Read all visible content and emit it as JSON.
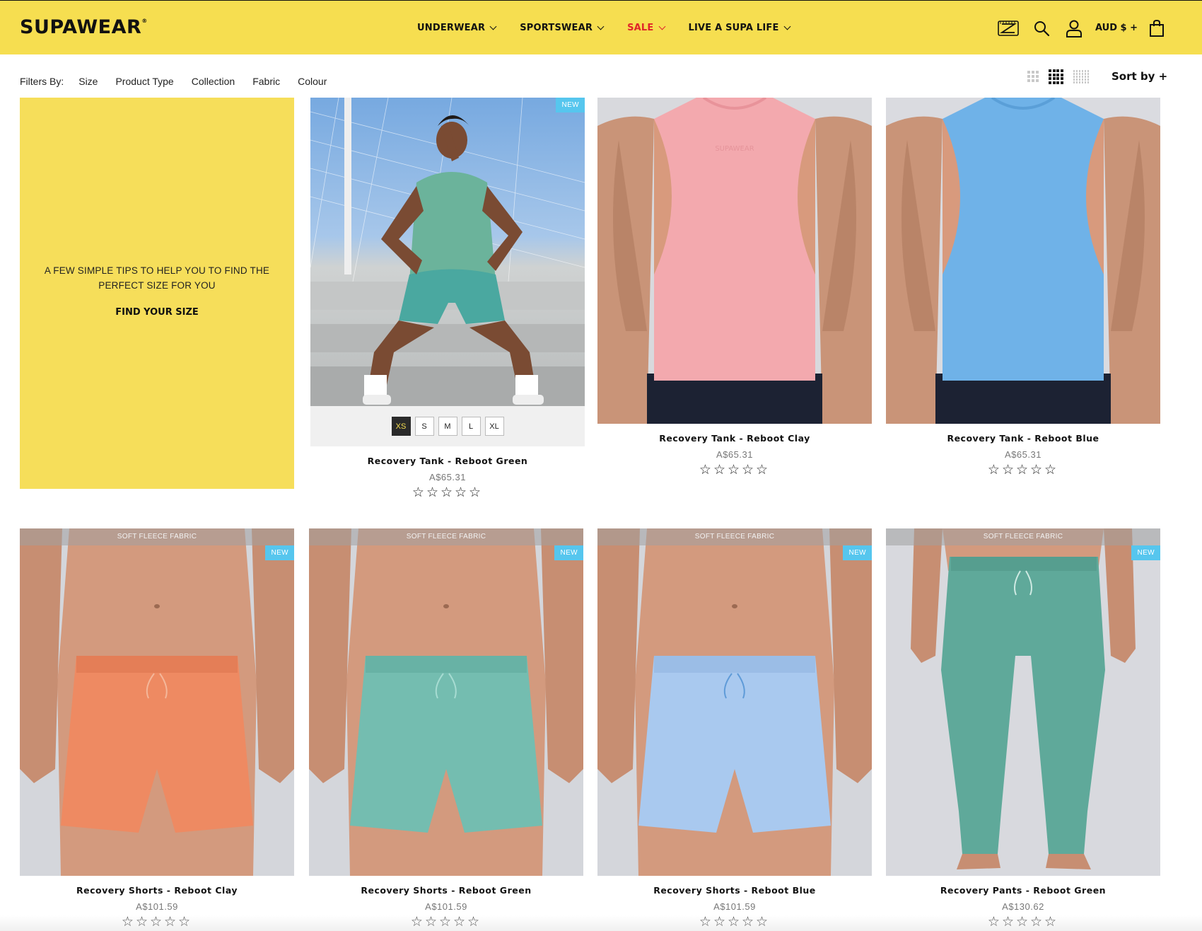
{
  "brand": {
    "logo_text": "SUPAWEAR",
    "logo_mark": "®"
  },
  "nav": {
    "items": [
      {
        "label": "UNDERWEAR"
      },
      {
        "label": "SPORTSWEAR"
      },
      {
        "label": "SALE"
      },
      {
        "label": "LIVE A SUPA LIFE"
      }
    ]
  },
  "header_right": {
    "currency": "AUD $ +"
  },
  "filters": {
    "label": "Filters By:",
    "items": [
      "Size",
      "Product Type",
      "Collection",
      "Fabric",
      "Colour"
    ]
  },
  "sort": {
    "label": "Sort by +"
  },
  "promo": {
    "text": "A FEW SIMPLE TIPS TO HELP YOU TO FIND THE PERFECT SIZE FOR YOU",
    "cta": "FIND YOUR SIZE"
  },
  "badges": {
    "new": "NEW",
    "fleece": "SOFT FLEECE FABRIC"
  },
  "sizes": [
    "XS",
    "S",
    "M",
    "L",
    "XL"
  ],
  "selected_size": "XS",
  "stars": "☆☆☆☆☆",
  "products": [
    {
      "title": "Recovery Tank - Reboot Green",
      "price": "A$65.31"
    },
    {
      "title": "Recovery Tank - Reboot Clay",
      "price": "A$65.31"
    },
    {
      "title": "Recovery Tank - Reboot Blue",
      "price": "A$65.31"
    },
    {
      "title": "Recovery Shorts - Reboot Clay",
      "price": "A$101.59"
    },
    {
      "title": "Recovery Shorts - Reboot Green",
      "price": "A$101.59"
    },
    {
      "title": "Recovery Shorts - Reboot Blue",
      "price": "A$101.59"
    },
    {
      "title": "Recovery Pants - Reboot Green",
      "price": "A$130.62"
    }
  ],
  "colors": {
    "header_bg": "#f6de50",
    "sale": "#e0242a",
    "badge_new": "#56c6ee",
    "tank_clay": "#f3a9ae",
    "tank_blue": "#6fb2e8",
    "tank_green": "#6bb39b",
    "shorts_clay": "#ee8a62",
    "shorts_green": "#74bdb0",
    "shorts_blue": "#a9c9ef",
    "pants_green": "#5fa99a"
  },
  "icons": [
    "size-guide-icon",
    "search-icon",
    "account-icon",
    "cart-icon",
    "grid-small-icon",
    "grid-medium-icon",
    "grid-large-icon"
  ]
}
